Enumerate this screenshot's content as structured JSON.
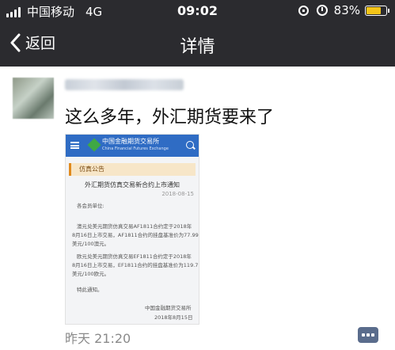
{
  "status_bar": {
    "carrier": "中国移动",
    "network": "4G",
    "time": "09:02",
    "battery_percent": "83%",
    "battery_level": 0.83,
    "battery_color": "#f5c518",
    "icons": [
      "signal-icon",
      "rotation-lock-icon",
      "alarm-icon",
      "battery-icon"
    ]
  },
  "nav": {
    "back_label": "返回",
    "title": "详情"
  },
  "post": {
    "text": "这么多年，外汇期货要来了",
    "time": "昨天 21:20"
  },
  "shared_card": {
    "logo_cn": "中国金融期货交易所",
    "logo_en": "China Financial Futures Exchange",
    "section": "仿真公告",
    "title": "外汇期货仿真交易新合约上市通知",
    "date": "2018-08-15",
    "lines": [
      "各会员单位:",
      "澳元兑美元期货仿真交易AF1811合约定于2018年",
      "8月16日上市交易，AF1811合约的挂盘基准价为77.99",
      "美元/100澳元。",
      "欧元兑美元期货仿真交易EF1811合约定于2018年",
      "8月16日上市交易，EF1811合约的挂盘基准价为119.71",
      "美元/100欧元。",
      "特此通知。",
      "中国金融期货交易所",
      "2018年8月15日"
    ]
  }
}
